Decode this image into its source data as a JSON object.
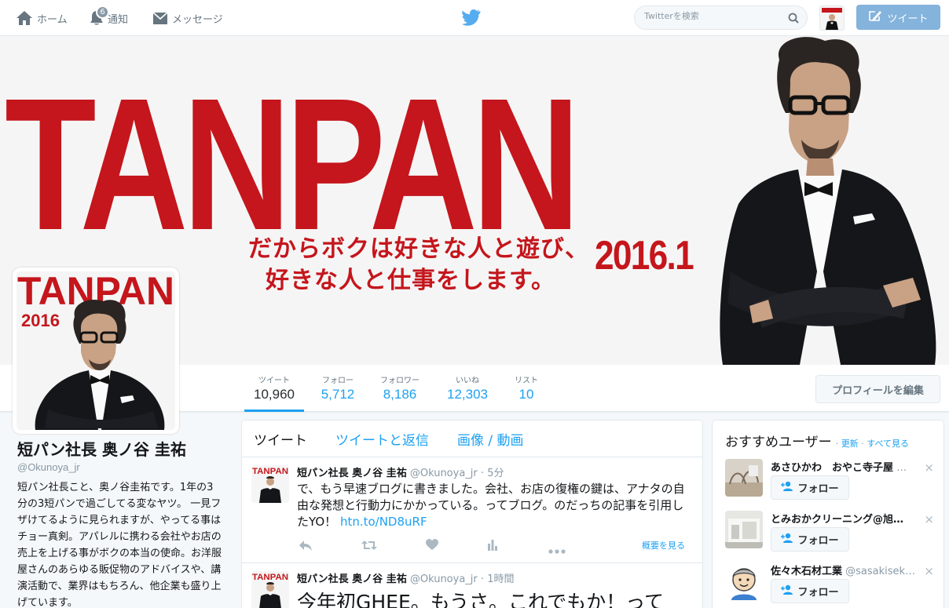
{
  "nav": {
    "home": "ホーム",
    "notifications": "通知",
    "notification_count": "6",
    "messages": "メッセージ",
    "search_placeholder": "Twitterを検索",
    "tweet_button": "ツイート"
  },
  "banner": {
    "title": "TANPAN",
    "tagline_1": "だからボクは好きな人と遊び、",
    "tagline_2": "好きな人と仕事をします。",
    "date": "2016.1",
    "brand_color": "#c4161c"
  },
  "avatar": {
    "title": "TANPAN",
    "year": "2016"
  },
  "stats": [
    {
      "label": "ツイート",
      "value": "10,960"
    },
    {
      "label": "フォロー",
      "value": "5,712"
    },
    {
      "label": "フォロワー",
      "value": "8,186"
    },
    {
      "label": "いいね",
      "value": "12,303"
    },
    {
      "label": "リスト",
      "value": "10"
    }
  ],
  "edit_profile": "プロフィールを編集",
  "profile": {
    "name": "短パン社長 奥ノ谷 圭祐",
    "handle": "@Okunoya_jr",
    "bio": "短パン社長こと、奥ノ谷圭祐です。1年の3分の3短パンで過ごしてる変なヤツ。 一見フザけてるように見られますが、やってる事はチョー真剣。アパレルに携わる会社やお店の売上を上げる事がボクの本当の使命。お洋服屋さんのあらゆる販促物のアドバイスや、講演活動で、業界はもちろん、他企業も盛り上げています。"
  },
  "timeline": {
    "tabs": [
      "ツイート",
      "ツイートと返信",
      "画像 / 動画"
    ],
    "tweets": [
      {
        "name": "短パン社長 奥ノ谷 圭祐",
        "handle": "@Okunoya_jr",
        "dot": "·",
        "time": "5分",
        "text": "で、もう早速ブログに書きました。会社、お店の復権の鍵は、アナタの自由な発想と行動力にかかっている。ってブログ。のだっちの記事を引用したYO！",
        "link": "htn.to/ND8uRF",
        "summary": "概要を見る",
        "avatar_label": "TANPAN"
      },
      {
        "name": "短パン社長 奥ノ谷 圭祐",
        "handle": "@Okunoya_jr",
        "dot": "·",
        "time": "1時間",
        "text": "今年初GHEE。もうさ。これでもか！って",
        "avatar_label": "TANPAN"
      }
    ]
  },
  "who_to_follow": {
    "title": "おすすめユーザー",
    "refresh": "更新",
    "view_all": "すべて見る",
    "sep": "·",
    "follow_label": "フォロー",
    "close": "×",
    "users": [
      {
        "name": "あさひかわ　おやこ寺子屋",
        "handle": "…"
      },
      {
        "name": "とみおかクリーニング@旭…",
        "handle": ""
      },
      {
        "name": "佐々木石材工業",
        "handle": "@sasakisek…"
      }
    ]
  },
  "colors": {
    "accent": "#1da1f2",
    "tweet_button_bg": "#84b3dc",
    "text_muted": "#8899a6"
  }
}
